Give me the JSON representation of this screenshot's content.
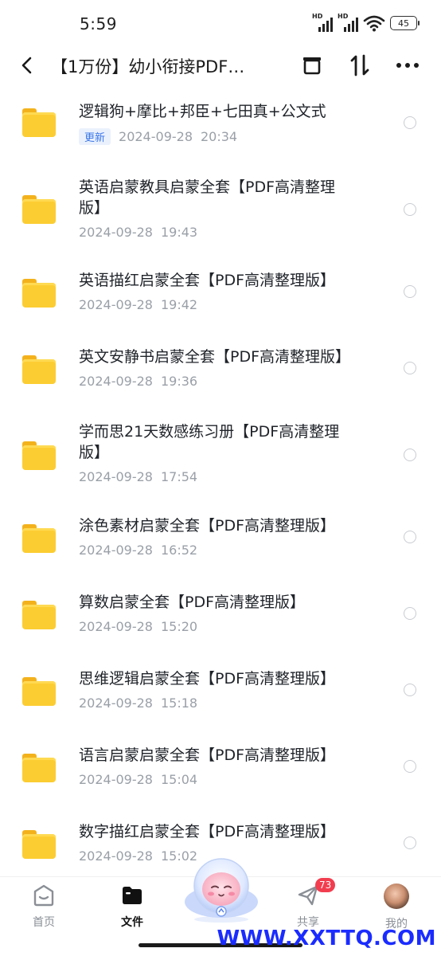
{
  "status_bar": {
    "time": "5:59",
    "signal1_tag": "HD",
    "signal2_tag": "HD",
    "battery": "45"
  },
  "nav": {
    "title": "【1万份】幼小衔接PDF…",
    "icons": [
      "back-icon",
      "archive-icon",
      "sort-icon",
      "more-icon"
    ]
  },
  "files": [
    {
      "title": "逻辑狗+摩比+邦臣+七田真+公文式",
      "badge": "更新",
      "date": "2024-09-28",
      "time": "20:34"
    },
    {
      "title": "英语启蒙教具启蒙全套【PDF高清整理版】",
      "date": "2024-09-28",
      "time": "19:43"
    },
    {
      "title": "英语描红启蒙全套【PDF高清整理版】",
      "date": "2024-09-28",
      "time": "19:42"
    },
    {
      "title": "英文安静书启蒙全套【PDF高清整理版】",
      "date": "2024-09-28",
      "time": "19:36"
    },
    {
      "title": "学而思21天数感练习册【PDF高清整理版】",
      "date": "2024-09-28",
      "time": "17:54"
    },
    {
      "title": "涂色素材启蒙全套【PDF高清整理版】",
      "date": "2024-09-28",
      "time": "16:52"
    },
    {
      "title": "算数启蒙全套【PDF高清整理版】",
      "date": "2024-09-28",
      "time": "15:20"
    },
    {
      "title": "思维逻辑启蒙全套【PDF高清整理版】",
      "date": "2024-09-28",
      "time": "15:18"
    },
    {
      "title": "语言启蒙启蒙全套【PDF高清整理版】",
      "date": "2024-09-28",
      "time": "15:04"
    },
    {
      "title": "数字描红启蒙全套【PDF高清整理版】",
      "date": "2024-09-28",
      "time": "15:02"
    }
  ],
  "tabbar": {
    "home": "首页",
    "files": "文件",
    "share": "共享",
    "share_badge": "73",
    "mine": "我的"
  },
  "watermark": "WWW.XXTTQ.COM",
  "colors": {
    "accent": "#3b76e8",
    "folder": "#fccd32",
    "badge_red": "#f23d4f",
    "watermark": "#1a2cff"
  }
}
